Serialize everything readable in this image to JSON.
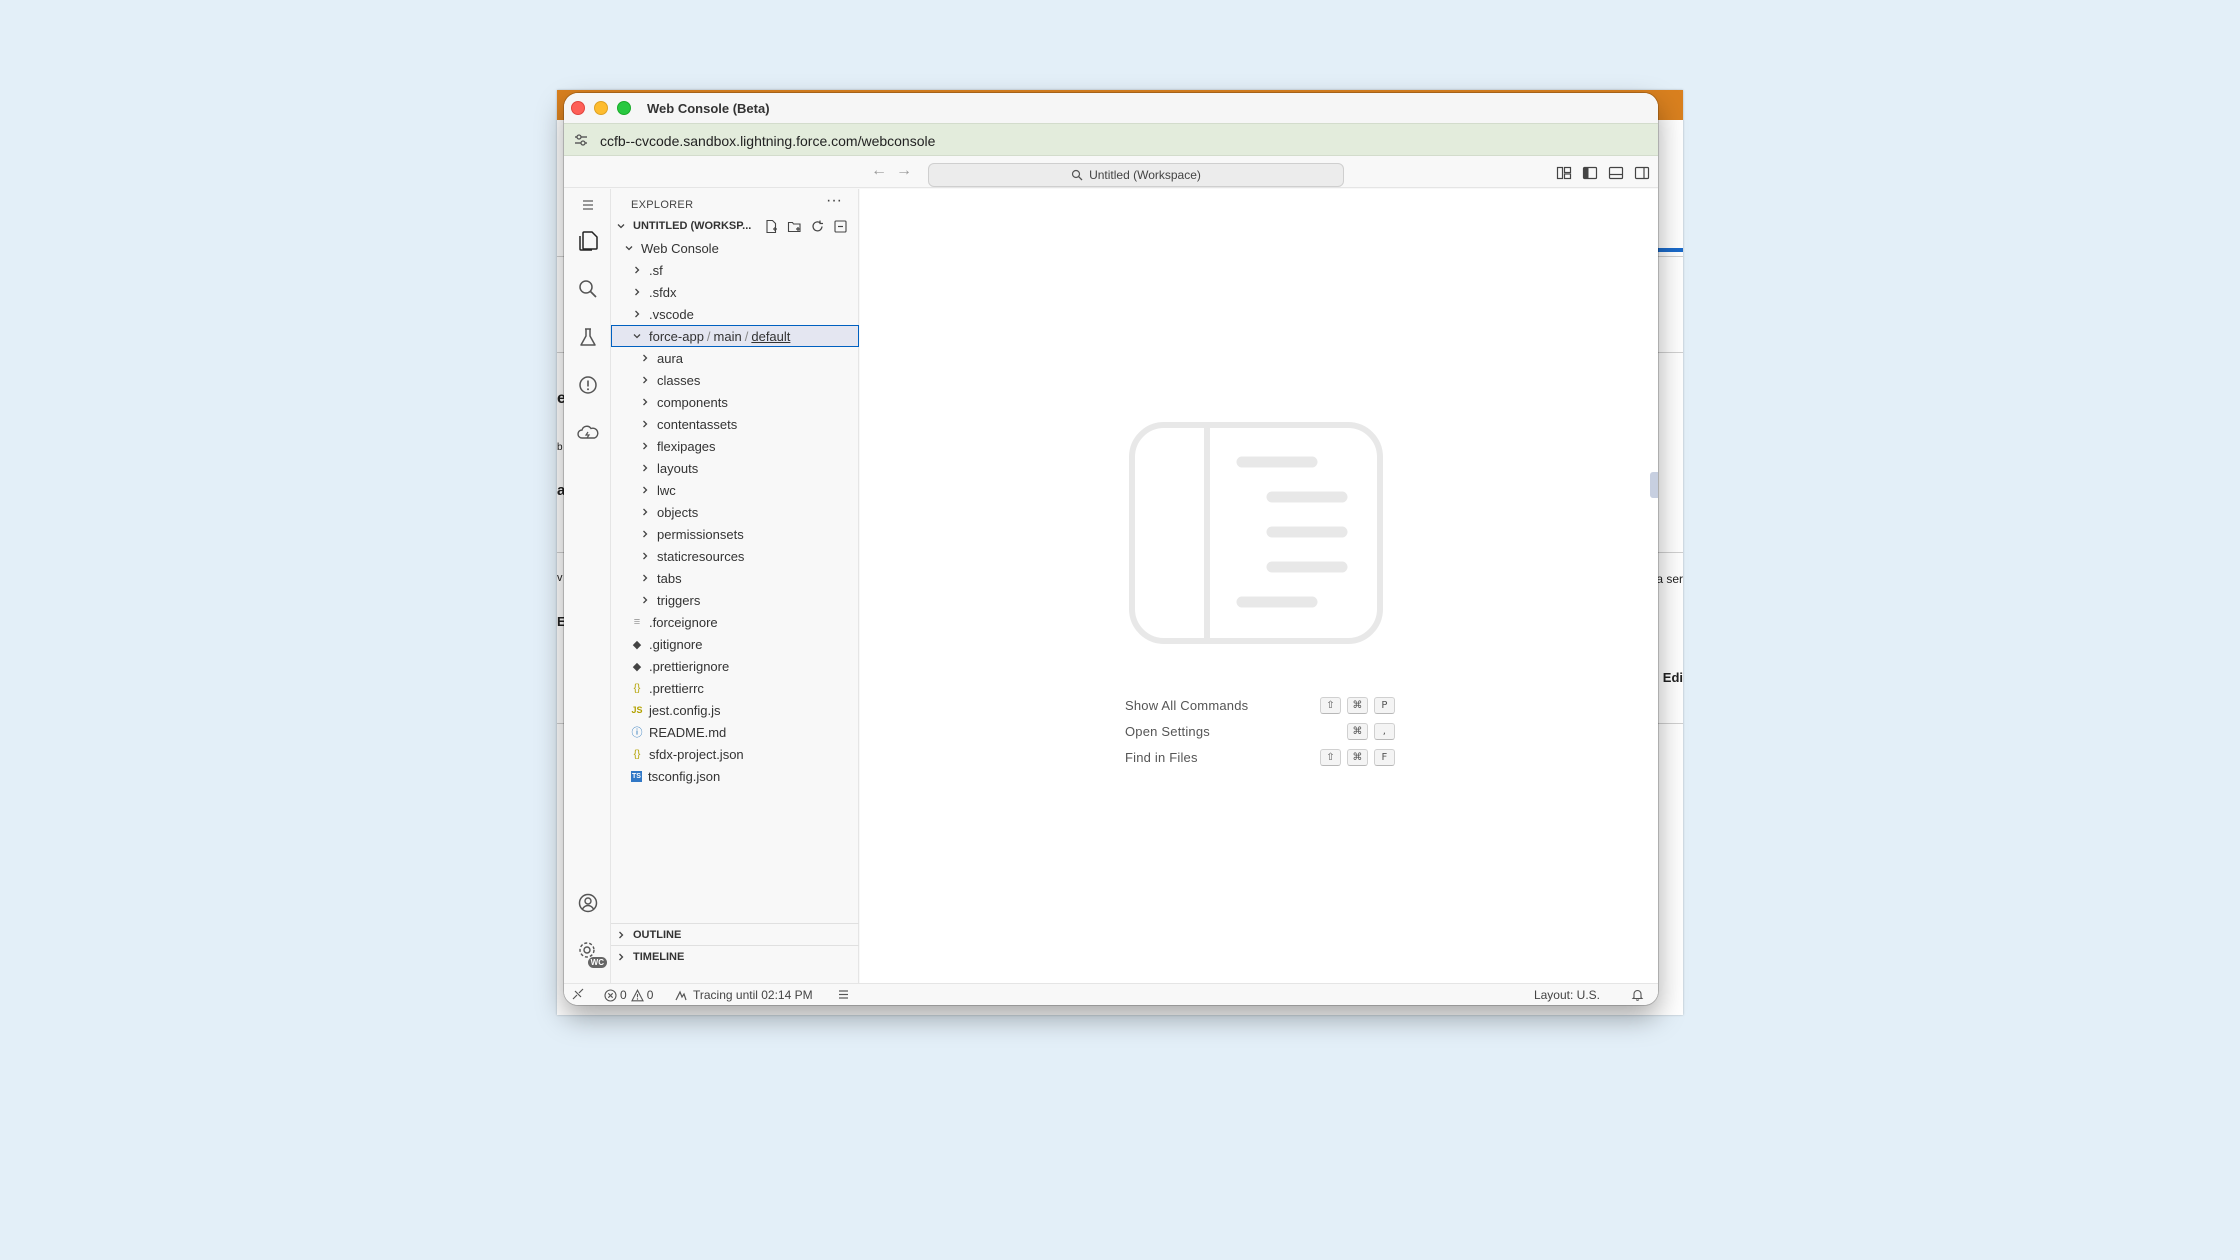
{
  "window": {
    "title": "Web Console (Beta)",
    "url": "ccfb--cvcode.sandbox.lightning.force.com/webconsole"
  },
  "command_center": {
    "label": "Untitled (Workspace)"
  },
  "explorer": {
    "header": "EXPLORER",
    "workspace_label": "UNTITLED (WORKSP...",
    "root_folder": "Web Console",
    "top_folders": [
      ".sf",
      ".sfdx",
      ".vscode"
    ],
    "selected_path": {
      "part1": "force-app",
      "part2": "main",
      "part3": "default"
    },
    "subfolders": [
      "aura",
      "classes",
      "components",
      "contentassets",
      "flexipages",
      "layouts",
      "lwc",
      "objects",
      "permissionsets",
      "staticresources",
      "tabs",
      "triggers"
    ],
    "files": [
      {
        "name": ".forceignore",
        "icon": "lines-file-icon"
      },
      {
        "name": ".gitignore",
        "icon": "git-diamond-icon"
      },
      {
        "name": ".prettierignore",
        "icon": "git-diamond-icon"
      },
      {
        "name": ".prettierrc",
        "icon": "braces-icon"
      },
      {
        "name": "jest.config.js",
        "icon": "js-icon"
      },
      {
        "name": "README.md",
        "icon": "info-icon"
      },
      {
        "name": "sfdx-project.json",
        "icon": "braces-icon"
      },
      {
        "name": "tsconfig.json",
        "icon": "ts-icon"
      }
    ],
    "outline_label": "OUTLINE",
    "timeline_label": "TIMELINE"
  },
  "shortcuts": [
    {
      "label": "Show All Commands",
      "keys": [
        "⇧",
        "⌘",
        "P"
      ]
    },
    {
      "label": "Open Settings",
      "keys": [
        "⌘",
        ","
      ]
    },
    {
      "label": "Find in Files",
      "keys": [
        "⇧",
        "⌘",
        "F"
      ]
    }
  ],
  "status": {
    "errors": "0",
    "warnings": "0",
    "tracing": "Tracing until 02:14 PM",
    "layout": "Layout: U.S."
  },
  "activity": {
    "account_badge": "WC"
  },
  "background_fragments": {
    "f1": "e",
    "f2": "b",
    "f3": "a",
    "f4": "v",
    "f5": "E",
    "f6": "a ser",
    "f7": ": Edi"
  },
  "colors": {
    "accent": "#0060c0",
    "selection": "#e4e6f1",
    "url_bar": "#e3ecdc",
    "desktop": "#e3eff8"
  }
}
